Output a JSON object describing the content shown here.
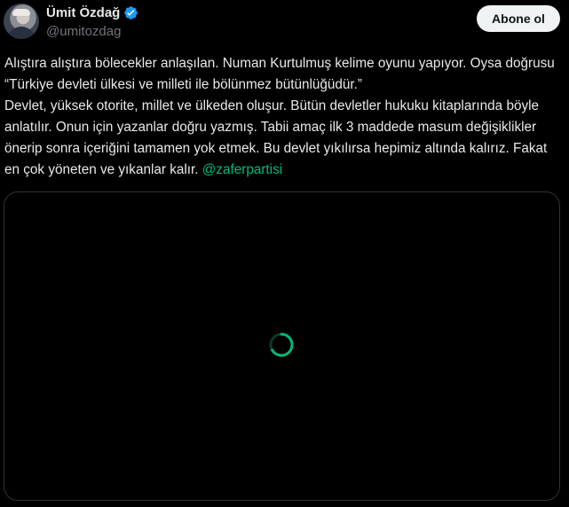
{
  "user": {
    "display_name": "Ümit Özdağ",
    "handle": "@umitozdag",
    "avatar_icon": "avatar-photo",
    "verified_icon": "verified-badge-icon"
  },
  "follow_button": {
    "label": "Abone ol"
  },
  "tweet": {
    "line1": "Alıştıra alıştıra bölecekler anlaşılan. Numan Kurtulmuş kelime oyunu yapıyor. Oysa doğrusu “Türkiye devleti ülkesi ve milleti ile bölünmez bütünlüğüdür.”",
    "line2": "Devlet, yüksek otorite, millet ve ülkeden oluşur. Bütün devletler hukuku kitaplarında böyle anlatılır. Onun için yazanlar doğru yazmış. Tabii amaç ilk 3 maddede masum değişiklikler önerip sonra içeriğini tamamen yok etmek. Bu devlet yıkılırsa hepimiz altında kalırız. Fakat en çok yöneten ve yıkanlar kalır.",
    "hashtag": "@zaferpartisi"
  },
  "media": {
    "state_icon": "loading-spinner-icon"
  },
  "colors": {
    "background": "#000000",
    "text": "#e7e9ea",
    "secondary_text": "#71767b",
    "link": "#00ba7c",
    "verified": "#1d9bf0",
    "spinner": "#00ba7c"
  }
}
